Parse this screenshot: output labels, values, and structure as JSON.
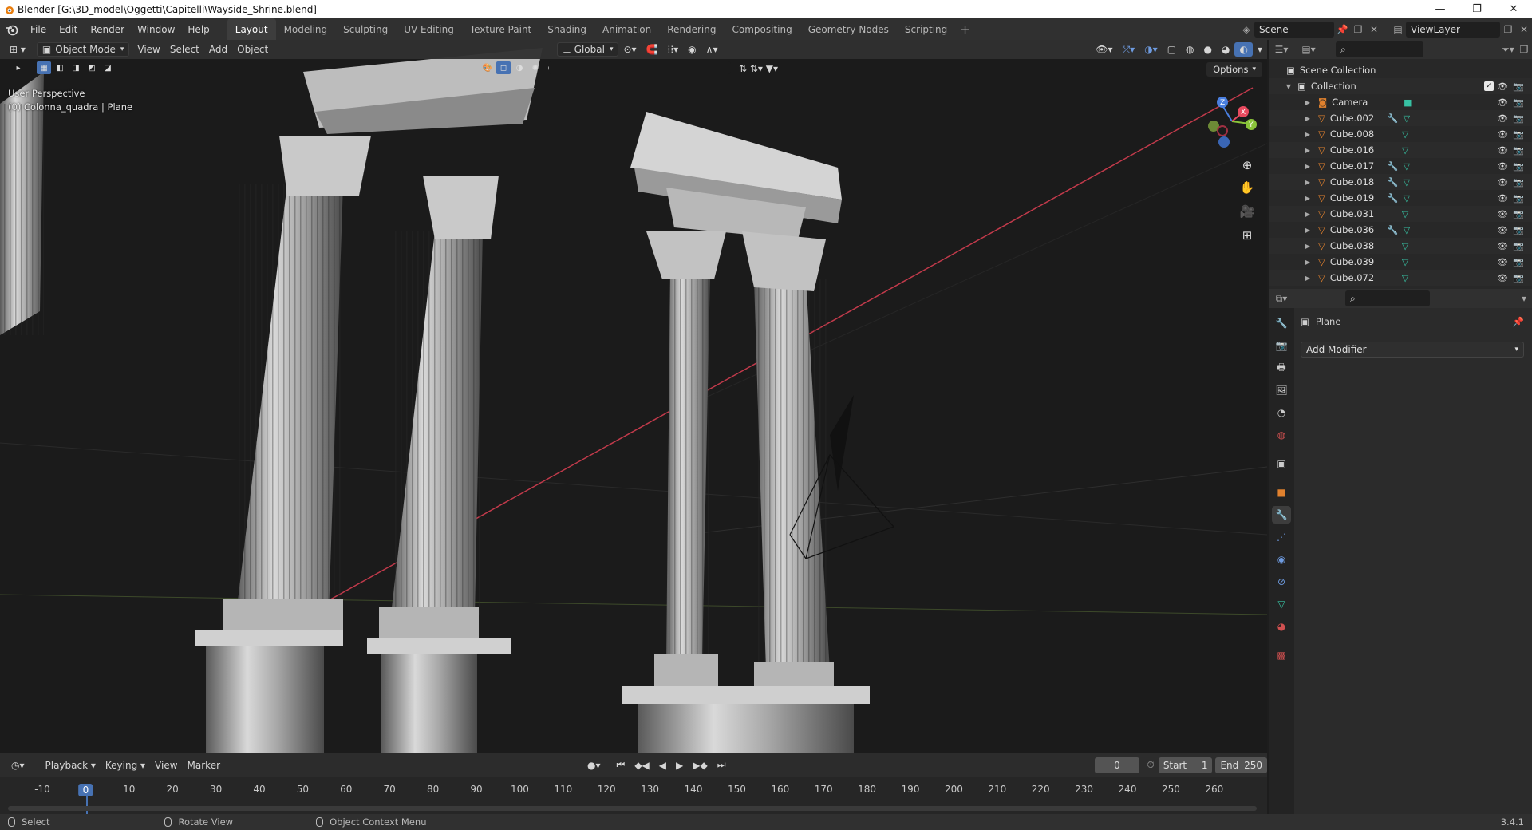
{
  "window": {
    "title": "Blender [G:\\3D_model\\Oggetti\\Capitelli\\Wayside_Shrine.blend]",
    "controls": [
      "—",
      "❐",
      "✕"
    ]
  },
  "menubar": {
    "items": [
      "File",
      "Edit",
      "Render",
      "Window",
      "Help"
    ]
  },
  "workspaces": {
    "tabs": [
      "Layout",
      "Modeling",
      "Sculpting",
      "UV Editing",
      "Texture Paint",
      "Shading",
      "Animation",
      "Rendering",
      "Compositing",
      "Geometry Nodes",
      "Scripting"
    ],
    "active": "Layout",
    "add_label": "+"
  },
  "scene": {
    "name": "Scene",
    "view_layer": "ViewLayer"
  },
  "viewport": {
    "mode": "Object Mode",
    "menus": [
      "View",
      "Select",
      "Add",
      "Object"
    ],
    "transform_orientation": "Global",
    "options_label": "Options",
    "overlay_line1": "User Perspective",
    "overlay_line2": "(0) Colonna_quadra | Plane",
    "gizmo": {
      "x": "X",
      "y": "Y",
      "z": "Z"
    }
  },
  "timeline": {
    "menus": [
      "Playback",
      "Keying",
      "View",
      "Marker"
    ],
    "current_frame": "0",
    "start_label": "Start",
    "start": "1",
    "end_label": "End",
    "end": "250",
    "ruler": [
      "-10",
      "0",
      "10",
      "20",
      "30",
      "40",
      "50",
      "60",
      "70",
      "80",
      "90",
      "100",
      "110",
      "120",
      "130",
      "140",
      "150",
      "160",
      "170",
      "180",
      "190",
      "200",
      "210",
      "220",
      "230",
      "240",
      "250",
      "260"
    ]
  },
  "statusbar": {
    "items": [
      "Select",
      "Rotate View",
      "Object Context Menu"
    ],
    "version": "3.4.1"
  },
  "outliner": {
    "scene_collection": "Scene Collection",
    "collection": "Collection",
    "objects": [
      {
        "name": "Camera",
        "type": "camera",
        "modifier": false
      },
      {
        "name": "Cube.002",
        "type": "mesh",
        "modifier": true
      },
      {
        "name": "Cube.008",
        "type": "mesh",
        "modifier": false
      },
      {
        "name": "Cube.016",
        "type": "mesh",
        "modifier": false
      },
      {
        "name": "Cube.017",
        "type": "mesh",
        "modifier": true
      },
      {
        "name": "Cube.018",
        "type": "mesh",
        "modifier": true
      },
      {
        "name": "Cube.019",
        "type": "mesh",
        "modifier": true
      },
      {
        "name": "Cube.031",
        "type": "mesh",
        "modifier": false
      },
      {
        "name": "Cube.036",
        "type": "mesh",
        "modifier": true
      },
      {
        "name": "Cube.038",
        "type": "mesh",
        "modifier": false
      },
      {
        "name": "Cube.039",
        "type": "mesh",
        "modifier": false
      },
      {
        "name": "Cube.072",
        "type": "mesh",
        "modifier": false
      }
    ]
  },
  "properties": {
    "object_name": "Plane",
    "add_modifier_label": "Add Modifier"
  },
  "colors": {
    "accent": "#4772b3",
    "object_orange": "#e0812e",
    "mesh_green": "#37c1a3",
    "x_axis": "#e84a5f",
    "y_axis": "#8ac43a",
    "z_axis": "#4a7fe0"
  }
}
